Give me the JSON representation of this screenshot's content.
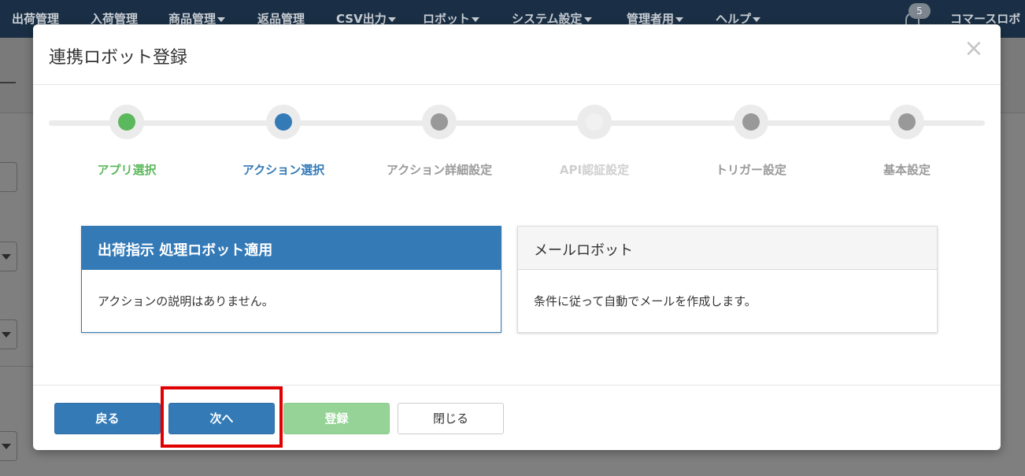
{
  "nav": {
    "items": [
      {
        "label": "出荷管理",
        "dropdown": false
      },
      {
        "label": "入荷管理",
        "dropdown": false
      },
      {
        "label": "商品管理",
        "dropdown": true
      },
      {
        "label": "返品管理",
        "dropdown": false
      },
      {
        "label": "CSV出力",
        "dropdown": true
      },
      {
        "label": "ロボット",
        "dropdown": true
      },
      {
        "label": "システム設定",
        "dropdown": true
      },
      {
        "label": "管理者用",
        "dropdown": true
      },
      {
        "label": "ヘルプ",
        "dropdown": true
      }
    ],
    "notification_count": "5",
    "company": "コマースロボ"
  },
  "modal": {
    "title": "連携ロボット登録",
    "close_icon": "×",
    "steps": [
      {
        "label": "アプリ選択",
        "state": "done"
      },
      {
        "label": "アクション選択",
        "state": "active"
      },
      {
        "label": "アクション詳細設定",
        "state": "pending"
      },
      {
        "label": "API認証設定",
        "state": "disabled"
      },
      {
        "label": "トリガー設定",
        "state": "pending"
      },
      {
        "label": "基本設定",
        "state": "pending"
      }
    ],
    "cards": [
      {
        "title": "出荷指示 処理ロボット適用",
        "description": "アクションの説明はありません。",
        "selected": true
      },
      {
        "title": "メールロボット",
        "description": "条件に従って自動でメールを作成します。",
        "selected": false
      }
    ],
    "buttons": {
      "back": "戻る",
      "next": "次へ",
      "register": "登録",
      "close": "閉じる"
    }
  },
  "colors": {
    "primary": "#337ab7",
    "success": "#5cb85c",
    "highlight": "#e00000"
  }
}
